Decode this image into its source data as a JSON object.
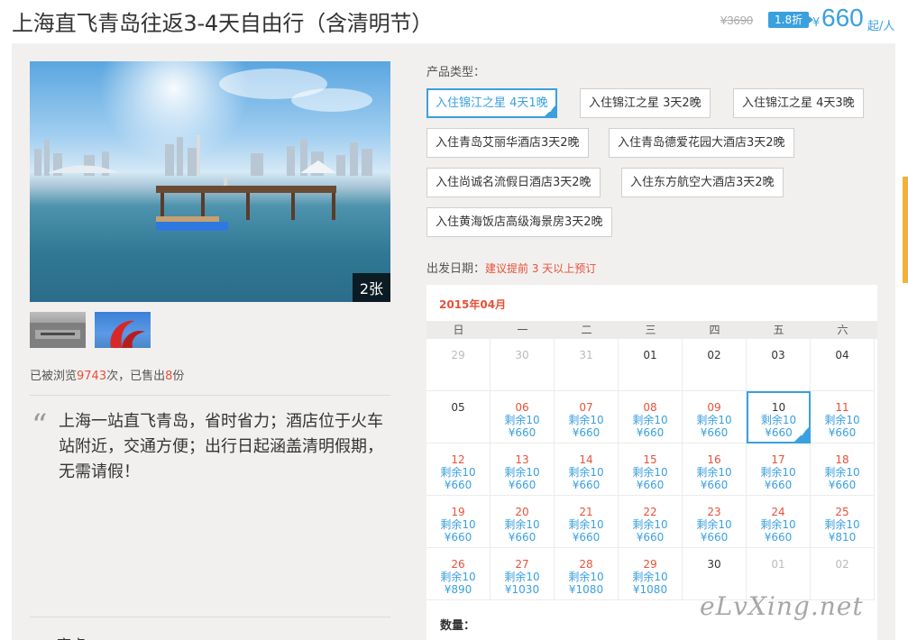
{
  "header": {
    "title": "上海直飞青岛往返3-4天自由行（含清明节）",
    "original_price": "¥3690",
    "discount": "1.8折",
    "price_symbol": "¥",
    "price": "660",
    "price_unit": "起/人"
  },
  "gallery": {
    "photo_count": "2张"
  },
  "stats": {
    "prefix": "已被浏览",
    "views": "9743",
    "mid": "次，已售出",
    "sold": "8",
    "suffix": "份"
  },
  "description": "上海一站直飞青岛，省时省力；酒店位于火车站附近，交通方便；出行日起涵盖清明假期，无需请假！",
  "bottom_partial": "亮点",
  "product": {
    "label": "产品类型：",
    "options": [
      "入住锦江之星 4天1晚",
      "入住锦江之星 3天2晚",
      "入住锦江之星 4天3晚",
      "入住青岛艾丽华酒店3天2晚",
      "入住青岛德爱花园大酒店3天2晚",
      "入住尚诚名流假日酒店3天2晚",
      "入住东方航空大酒店3天2晚",
      "入住黄海饭店高级海景房3天2晚"
    ],
    "selected_index": 0
  },
  "departure": {
    "label": "出发日期：",
    "hint": "建议提前 3 天以上预订"
  },
  "calendar": {
    "month": "2015年04月",
    "weekdays": [
      "日",
      "一",
      "二",
      "三",
      "四",
      "五",
      "六"
    ],
    "selected_date": "10",
    "rows": [
      [
        {
          "d": "29",
          "s": "muted"
        },
        {
          "d": "30",
          "s": "muted"
        },
        {
          "d": "31",
          "s": "muted"
        },
        {
          "d": "01",
          "s": "plain"
        },
        {
          "d": "02",
          "s": "plain"
        },
        {
          "d": "03",
          "s": "plain"
        },
        {
          "d": "04",
          "s": "plain"
        }
      ],
      [
        {
          "d": "05",
          "s": "plain"
        },
        {
          "d": "06",
          "s": "avail",
          "r": "剩余10",
          "p": "¥660"
        },
        {
          "d": "07",
          "s": "avail",
          "r": "剩余10",
          "p": "¥660"
        },
        {
          "d": "08",
          "s": "avail",
          "r": "剩余10",
          "p": "¥660"
        },
        {
          "d": "09",
          "s": "avail",
          "r": "剩余10",
          "p": "¥660"
        },
        {
          "d": "10",
          "s": "sel",
          "r": "剩余10",
          "p": "¥660"
        },
        {
          "d": "11",
          "s": "avail",
          "r": "剩余10",
          "p": "¥660"
        }
      ],
      [
        {
          "d": "12",
          "s": "avail",
          "r": "剩余10",
          "p": "¥660"
        },
        {
          "d": "13",
          "s": "avail",
          "r": "剩余10",
          "p": "¥660"
        },
        {
          "d": "14",
          "s": "avail",
          "r": "剩余10",
          "p": "¥660"
        },
        {
          "d": "15",
          "s": "avail",
          "r": "剩余10",
          "p": "¥660"
        },
        {
          "d": "16",
          "s": "avail",
          "r": "剩余10",
          "p": "¥660"
        },
        {
          "d": "17",
          "s": "avail",
          "r": "剩余10",
          "p": "¥660"
        },
        {
          "d": "18",
          "s": "avail",
          "r": "剩余10",
          "p": "¥660"
        }
      ],
      [
        {
          "d": "19",
          "s": "avail",
          "r": "剩余10",
          "p": "¥660"
        },
        {
          "d": "20",
          "s": "avail",
          "r": "剩余10",
          "p": "¥660"
        },
        {
          "d": "21",
          "s": "avail",
          "r": "剩余10",
          "p": "¥660"
        },
        {
          "d": "22",
          "s": "avail",
          "r": "剩余10",
          "p": "¥660"
        },
        {
          "d": "23",
          "s": "avail",
          "r": "剩余10",
          "p": "¥660"
        },
        {
          "d": "24",
          "s": "avail",
          "r": "剩余10",
          "p": "¥660"
        },
        {
          "d": "25",
          "s": "avail",
          "r": "剩余10",
          "p": "¥810"
        }
      ],
      [
        {
          "d": "26",
          "s": "avail",
          "r": "剩余10",
          "p": "¥890"
        },
        {
          "d": "27",
          "s": "avail",
          "r": "剩余10",
          "p": "¥1030"
        },
        {
          "d": "28",
          "s": "avail",
          "r": "剩余10",
          "p": "¥1080"
        },
        {
          "d": "29",
          "s": "avail",
          "r": "剩余10",
          "p": "¥1080"
        },
        {
          "d": "30",
          "s": "plain"
        },
        {
          "d": "01",
          "s": "muted"
        },
        {
          "d": "02",
          "s": "muted"
        }
      ]
    ]
  },
  "quantity_label": "数量：",
  "watermark": "eLvXing.net",
  "colors": {
    "accent": "#3aa0e0",
    "highlight": "#e8513a",
    "panel": "#f1f0ef"
  }
}
